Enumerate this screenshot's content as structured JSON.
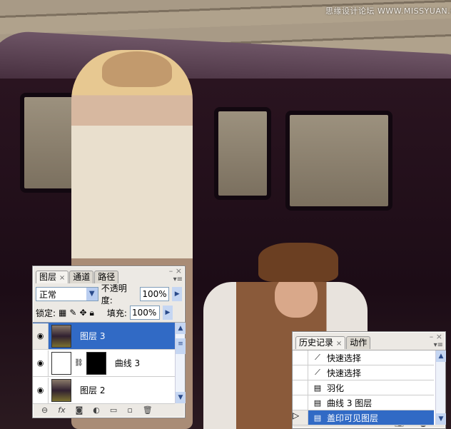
{
  "watermark": "思缘设计论坛 WWW.MISSYUAN.COM",
  "layers_panel": {
    "tabs": [
      "图层",
      "通道",
      "路径"
    ],
    "blend_mode": "正常",
    "opacity_label": "不透明度:",
    "opacity": "100%",
    "lock_label": "锁定:",
    "fill_label": "填充:",
    "fill": "100%",
    "layers": [
      {
        "name": "图层 3",
        "selected": true
      },
      {
        "name": "曲线 3",
        "selected": false
      },
      {
        "name": "图层 2",
        "selected": false
      }
    ]
  },
  "history_panel": {
    "tabs": [
      "历史记录",
      "动作"
    ],
    "items": [
      {
        "name": "快速选择",
        "icon": "quick-select-icon"
      },
      {
        "name": "快速选择",
        "icon": "quick-select-icon"
      },
      {
        "name": "羽化",
        "icon": "action-icon"
      },
      {
        "name": "曲线 3 图层",
        "icon": "action-icon"
      },
      {
        "name": "盖印可见图层",
        "icon": "action-icon",
        "selected": true
      }
    ]
  }
}
